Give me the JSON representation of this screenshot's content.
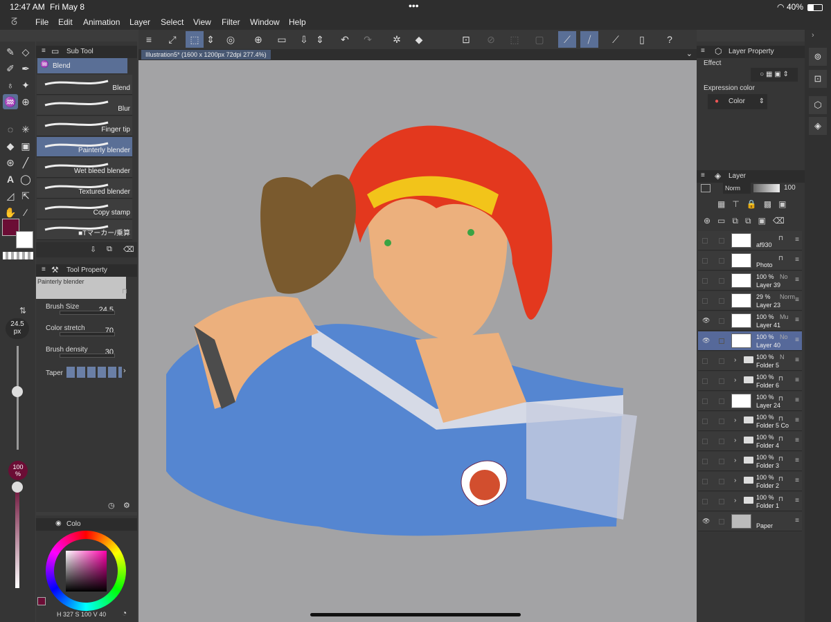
{
  "status": {
    "time": "12:47 AM",
    "date": "Fri May 8",
    "battery": "40%",
    "dots": "•••"
  },
  "menu": [
    "File",
    "Edit",
    "Animation",
    "Layer",
    "Select",
    "View",
    "Filter",
    "Window",
    "Help"
  ],
  "canvas_tab": "Illustration5* (1600 x 1200px 72dpi 277.4%)",
  "subtool": {
    "title": "Sub Tool",
    "group": "Blend",
    "brushes": [
      "Blend",
      "Blur",
      "Finger tip",
      "Painterly blender",
      "Wet bleed blender",
      "Textured blender",
      "Copy stamp",
      "■Tマーカー/乗算"
    ],
    "selected": "Painterly blender"
  },
  "toolprop": {
    "title": "Tool Property",
    "tool": "Painterly blender",
    "brush_size_label": "Brush Size",
    "brush_size": "24.5",
    "color_stretch_label": "Color stretch",
    "color_stretch": "70",
    "brush_density_label": "Brush density",
    "brush_density": "30",
    "taper_label": "Taper"
  },
  "left_slider": {
    "size": "24.5",
    "unit": "px",
    "opacity": "100",
    "opacity_unit": "%"
  },
  "colorpanel": {
    "tab": "Colo",
    "h": "327",
    "s": "100",
    "v": "40"
  },
  "colors": {
    "main": "#6b0d35",
    "sub": "#ffffff",
    "accent": "#5a6f96"
  },
  "layer_property": {
    "title": "Layer Property",
    "effect_label": "Effect",
    "expression_label": "Expression color",
    "expression_value": "Color"
  },
  "layer_panel": {
    "title": "Layer",
    "blend": "Norm",
    "opacity": "100"
  },
  "layers": [
    {
      "pct": "",
      "name": "af930",
      "kind": "raster",
      "eye": false,
      "locked": true
    },
    {
      "pct": "",
      "name": "Photo",
      "kind": "raster",
      "eye": false,
      "locked": true
    },
    {
      "pct": "100 %",
      "mode": "No",
      "name": "Layer 39",
      "kind": "raster",
      "eye": false
    },
    {
      "pct": "29 %",
      "mode": "Norm",
      "name": "Layer 23",
      "kind": "raster",
      "eye": false
    },
    {
      "pct": "100 %",
      "mode": "Mu",
      "name": "Layer 41",
      "kind": "raster",
      "eye": true
    },
    {
      "pct": "100 %",
      "mode": "No",
      "name": "Layer 40",
      "kind": "raster",
      "eye": true,
      "selected": true
    },
    {
      "pct": "100 %",
      "mode": "N",
      "name": "Folder 5",
      "kind": "folder",
      "eye": false
    },
    {
      "pct": "100 %",
      "name": "Folder 6",
      "kind": "folder",
      "eye": false,
      "locked": true
    },
    {
      "pct": "100 %",
      "name": "Layer 24",
      "kind": "raster",
      "eye": false,
      "locked": true
    },
    {
      "pct": "100 %",
      "name": "Folder 5 Co",
      "kind": "folder",
      "eye": false,
      "locked": true
    },
    {
      "pct": "100 %",
      "name": "Folder 4",
      "kind": "folder",
      "eye": false,
      "locked": true
    },
    {
      "pct": "100 %",
      "name": "Folder 3",
      "kind": "folder",
      "eye": false,
      "locked": true
    },
    {
      "pct": "100 %",
      "name": "Folder 2",
      "kind": "folder",
      "eye": false,
      "locked": true
    },
    {
      "pct": "100 %",
      "name": "Folder 1",
      "kind": "folder",
      "eye": false,
      "locked": true
    },
    {
      "pct": "",
      "name": "Paper",
      "kind": "paper",
      "eye": true
    }
  ]
}
